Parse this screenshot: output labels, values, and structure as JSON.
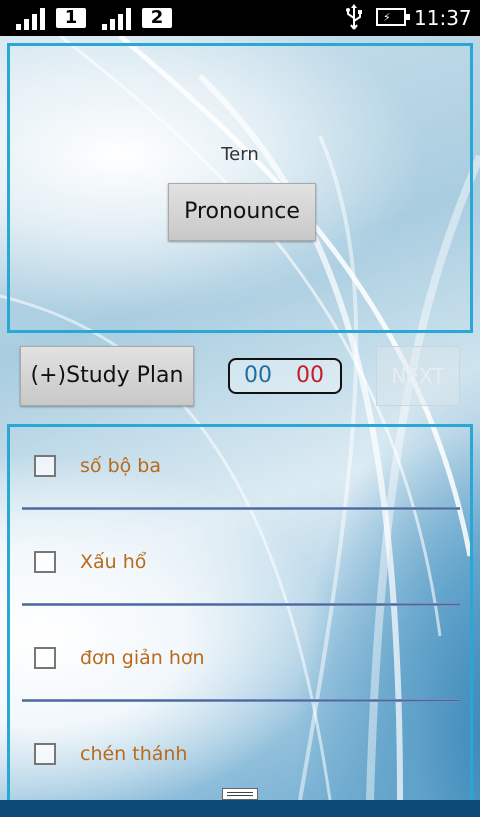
{
  "status_bar": {
    "sim1_label": "1",
    "sim2_label": "2",
    "usb_icon": "usb-icon",
    "battery_icon": "battery-charging-icon",
    "time": "11:37"
  },
  "term_panel": {
    "term_label": "Tern",
    "pronounce_label": "Pronounce"
  },
  "controls": {
    "study_plan_label": "(+)Study Plan",
    "timer_minutes": "00",
    "timer_seconds": "00",
    "next_label": "NEXT"
  },
  "answers": [
    {
      "label": "số bộ ba",
      "checked": false
    },
    {
      "label": "Xấu hổ",
      "checked": false
    },
    {
      "label": "đơn giản hơn",
      "checked": false
    },
    {
      "label": "chén thánh",
      "checked": false
    }
  ],
  "colors": {
    "accent_border": "#29a8d8",
    "answer_text": "#b96a1b",
    "timer_minutes": "#1e6fa0",
    "timer_seconds": "#c41c2a"
  }
}
